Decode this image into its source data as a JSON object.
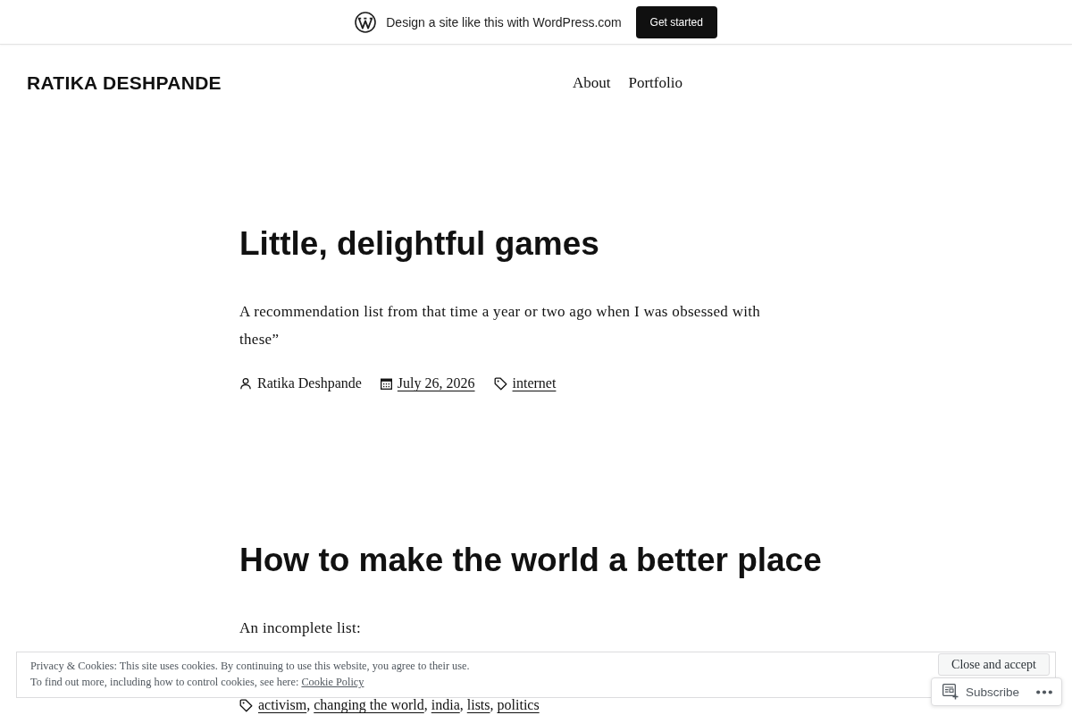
{
  "promo_bar": {
    "text": "Design a site like this with WordPress.com",
    "button": "Get started"
  },
  "header": {
    "site_title": "RATIKA DESHPANDE",
    "nav": [
      "About",
      "Portfolio"
    ]
  },
  "posts": [
    {
      "title": "Little, delightful games",
      "excerpt": "A recommendation list from that time a year or two ago when I was obsessed with these”",
      "author": "Ratika Deshpande",
      "date": "July 26, 2026",
      "tags": [
        "internet"
      ]
    },
    {
      "title": "How to make the world a better place",
      "excerpt": "An incomplete list:",
      "tags": [
        "activism",
        "changing the world",
        "india",
        "lists",
        "politics"
      ]
    }
  ],
  "tag_separator": ",",
  "cookie_banner": {
    "lines": [
      "Privacy & Cookies: This site uses cookies. By continuing to use this website, you agree to their use.",
      "To find out more, including how to control cookies, see here:"
    ],
    "link": "Cookie Policy",
    "button": "Close and accept"
  },
  "subscribe_bar": {
    "button": "Subscribe"
  }
}
